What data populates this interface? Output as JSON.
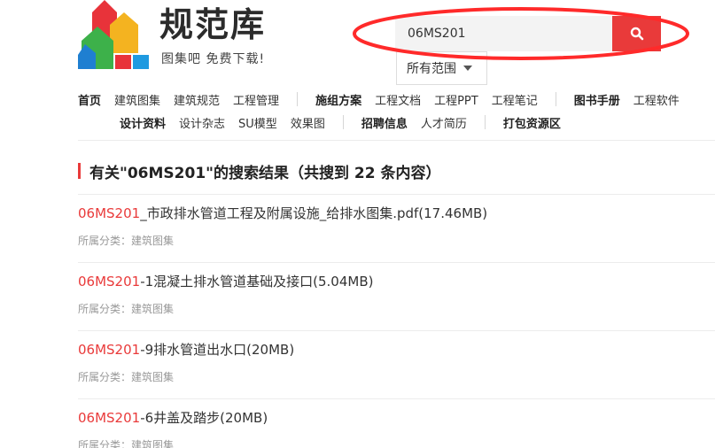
{
  "header": {
    "logo_title": "规范库",
    "logo_slogan": "图集吧 免费下载!",
    "search": {
      "value": "06MS201",
      "placeholder": ""
    },
    "scope_label": "所有范围",
    "colors": {
      "accent": "#e93a3a",
      "annotation": "#ff2a2a"
    }
  },
  "nav": {
    "row1": [
      {
        "label": "首页",
        "bold": true
      },
      {
        "label": "建筑图集"
      },
      {
        "label": "建筑规范"
      },
      {
        "label": "工程管理"
      },
      {
        "label": "施组方案",
        "bold": true
      },
      {
        "label": "工程文档"
      },
      {
        "label": "工程PPT"
      },
      {
        "label": "工程笔记"
      },
      {
        "label": "图书手册",
        "bold": true
      },
      {
        "label": "工程软件"
      }
    ],
    "row2": [
      {
        "label": "设计资料",
        "bold": true
      },
      {
        "label": "设计杂志"
      },
      {
        "label": "SU模型"
      },
      {
        "label": "效果图"
      },
      {
        "label": "招聘信息",
        "bold": true
      },
      {
        "label": "人才简历"
      },
      {
        "label": "打包资源区",
        "bold": true
      }
    ]
  },
  "results": {
    "title": "有关\"06MS201\"的搜索结果（共搜到 22 条内容）",
    "keyword": "06MS201",
    "items": [
      {
        "rest": "_市政排水管道工程及附属设施_给排水图集.pdf(17.46MB)",
        "category": "所属分类：建筑图集"
      },
      {
        "rest": "-1混凝土排水管道基础及接口(5.04MB)",
        "category": "所属分类：建筑图集"
      },
      {
        "rest": "-9排水管道出水口(20MB)",
        "category": "所属分类：建筑图集"
      },
      {
        "rest": "-6井盖及踏步(20MB)",
        "category": "所属分类：建筑图集"
      }
    ]
  }
}
